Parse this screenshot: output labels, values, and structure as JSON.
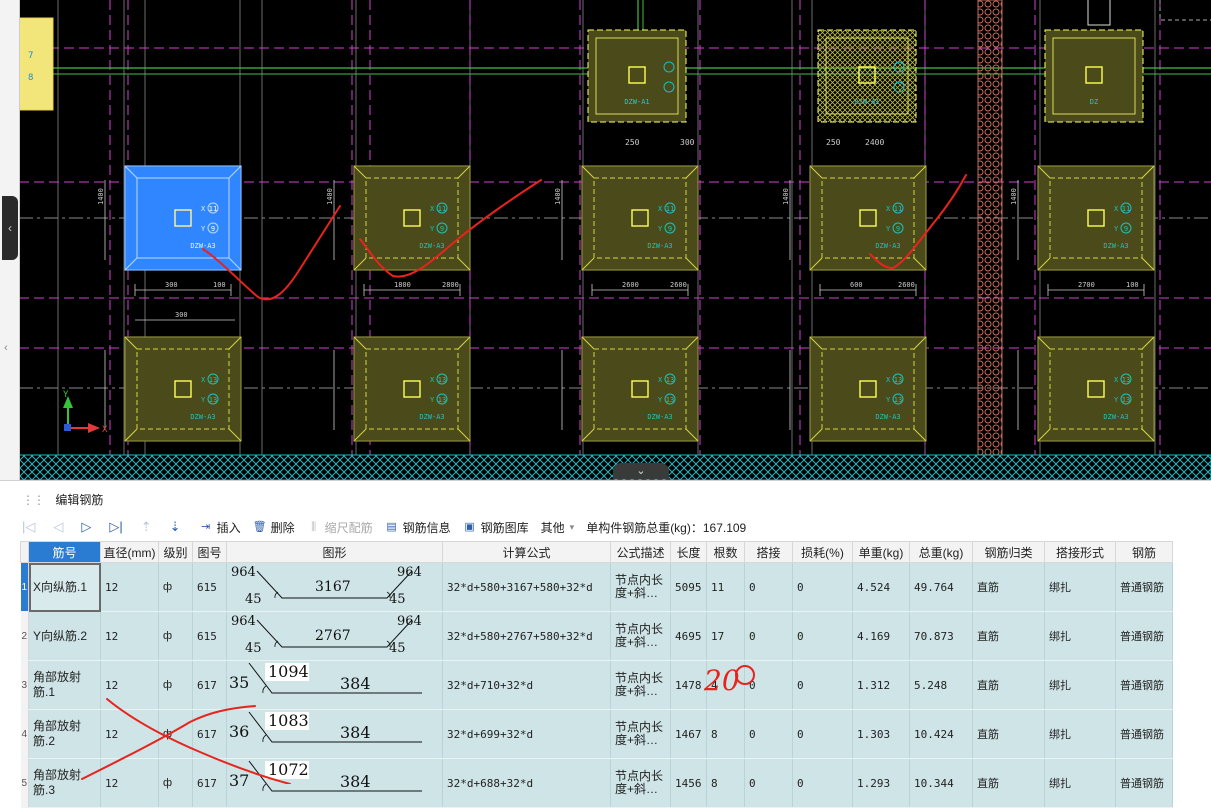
{
  "cad": {
    "column_labels": [
      "DZW-A3",
      "DZW-A3",
      "DZW-A3",
      "DZW-A3",
      "DZW-A3",
      "DZW-A3",
      "DZW-A3",
      "DZW-A3",
      "DZW-A3",
      "DZW-A3"
    ],
    "top_labels": [
      "DZW-A1",
      "DZW-A1",
      "DZ"
    ],
    "row1_bubbles": [
      [
        "11",
        "9"
      ],
      [
        "11",
        "9"
      ],
      [
        "11",
        "9"
      ],
      [
        "11",
        "9"
      ],
      [
        "11",
        "9"
      ]
    ],
    "row2_bubbles": [
      [
        "13",
        "13"
      ],
      [
        "13",
        "13"
      ],
      [
        "13",
        "13"
      ],
      [
        "13",
        "13"
      ],
      [
        "13",
        "13"
      ]
    ],
    "top_bubbles": [
      [
        "5",
        "5"
      ],
      [
        "5",
        "7"
      ]
    ],
    "leftcol_bubbles": [
      "7",
      "8"
    ],
    "dims_row1": [
      "300",
      "100",
      "1800",
      "2800",
      "2600",
      "2600",
      "600",
      "2600",
      "2700",
      "100"
    ],
    "dims_row1_side": [
      "1400",
      "1400",
      "1400",
      "1400",
      "1400",
      "1400",
      "1400",
      "1400",
      "1400",
      "1400"
    ],
    "dims_top": [
      "250",
      "300",
      "250",
      "2400"
    ],
    "dim_mid": "300",
    "colors": {
      "background": "#000000",
      "selected_fill": "#2f86ff",
      "footing_fill": "#4a4a1a",
      "footing_edge": "#d7d745",
      "magenta": "#d040d0",
      "cyan": "#20c0c0",
      "hatch": "#1fb9c6"
    }
  },
  "panel": {
    "title": "编辑钢筋",
    "toolbar": {
      "insert": "插入",
      "delete": "删除",
      "scale": "缩尺配筋",
      "info": "钢筋信息",
      "library": "钢筋图库",
      "other": "其他",
      "total_label": "单构件钢筋总重(kg)：167.109"
    },
    "columns": [
      "筋号",
      "直径(mm)",
      "级别",
      "图号",
      "图形",
      "计算公式",
      "公式描述",
      "长度",
      "根数",
      "搭接",
      "损耗(%)",
      "单重(kg)",
      "总重(kg)",
      "钢筋归类",
      "搭接形式",
      "钢筋"
    ],
    "rows": [
      {
        "rn": "1",
        "name": "X向纵筋.1",
        "dia": "12",
        "grade": "ф",
        "fig": "615",
        "shape": {
          "a": "964",
          "b": "45",
          "c": "3167",
          "d": "964",
          "e": "45"
        },
        "formula": "32*d+580+3167+580+32*d",
        "desc": "节点内长度+斜…",
        "len": "5095",
        "count": "11",
        "lap": "0",
        "loss": "0",
        "unit": "4.524",
        "total": "49.764",
        "cat": "直筋",
        "lapform": "绑扎",
        "rtype": "普通钢筋"
      },
      {
        "rn": "2",
        "name": "Y向纵筋.2",
        "dia": "12",
        "grade": "ф",
        "fig": "615",
        "shape": {
          "a": "964",
          "b": "45",
          "c": "2767",
          "d": "964",
          "e": "45"
        },
        "formula": "32*d+580+2767+580+32*d",
        "desc": "节点内长度+斜…",
        "len": "4695",
        "count": "17",
        "lap": "0",
        "loss": "0",
        "unit": "4.169",
        "total": "70.873",
        "cat": "直筋",
        "lapform": "绑扎",
        "rtype": "普通钢筋"
      },
      {
        "rn": "3",
        "name": "角部放射筋.1",
        "dia": "12",
        "grade": "ф",
        "fig": "617",
        "shape": {
          "a": "35",
          "b": "1094",
          "c": "384"
        },
        "formula": "32*d+710+32*d",
        "desc": "节点内长度+斜…",
        "len": "1478",
        "count": "4",
        "lap": "0",
        "loss": "0",
        "unit": "1.312",
        "total": "5.248",
        "cat": "直筋",
        "lapform": "绑扎",
        "rtype": "普通钢筋"
      },
      {
        "rn": "4",
        "name": "角部放射筋.2",
        "dia": "12",
        "grade": "ф",
        "fig": "617",
        "shape": {
          "a": "36",
          "b": "1083",
          "c": "384"
        },
        "formula": "32*d+699+32*d",
        "desc": "节点内长度+斜…",
        "len": "1467",
        "count": "8",
        "lap": "0",
        "loss": "0",
        "unit": "1.303",
        "total": "10.424",
        "cat": "直筋",
        "lapform": "绑扎",
        "rtype": "普通钢筋"
      },
      {
        "rn": "5",
        "name": "角部放射筋.3",
        "dia": "12",
        "grade": "ф",
        "fig": "617",
        "shape": {
          "a": "37",
          "b": "1072",
          "c": "384"
        },
        "formula": "32*d+688+32*d",
        "desc": "节点内长度+斜…",
        "len": "1456",
        "count": "8",
        "lap": "0",
        "loss": "0",
        "unit": "1.293",
        "total": "10.344",
        "cat": "直筋",
        "lapform": "绑扎",
        "rtype": "普通钢筋"
      }
    ]
  },
  "handwriting": {
    "note": "20"
  }
}
